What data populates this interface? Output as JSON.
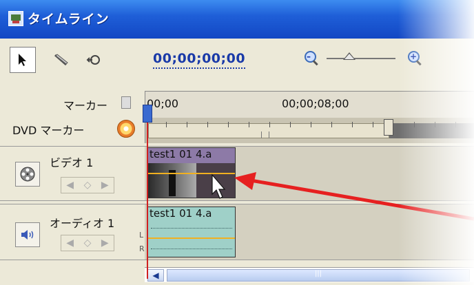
{
  "window": {
    "title": "タイムライン"
  },
  "toolbar": {
    "timecode": "00;00;00;00",
    "icons": [
      "selection-arrow-icon",
      "razor-icon",
      "hand-zoom-icon",
      "zoom-out-icon",
      "zoom-in-icon"
    ]
  },
  "header": {
    "marker_label": "マーカー",
    "dvd_marker_label": "DVD マーカー",
    "ruler_ticks": [
      "00;00",
      "00;00;08;00"
    ]
  },
  "tracks": {
    "video": {
      "name": "ビデオ 1",
      "clip_label": "test1 01 4.a"
    },
    "audio": {
      "name": "オーディオ 1",
      "clip_label": "test1 01 4.a",
      "channels": [
        "L",
        "R"
      ]
    }
  },
  "colors": {
    "title_bar": "#1f5fd8",
    "video_clip": "#8d7aa7",
    "audio_clip": "#9fd0c8",
    "annotation_arrow": "#e62020",
    "playhead": "#d02020"
  }
}
